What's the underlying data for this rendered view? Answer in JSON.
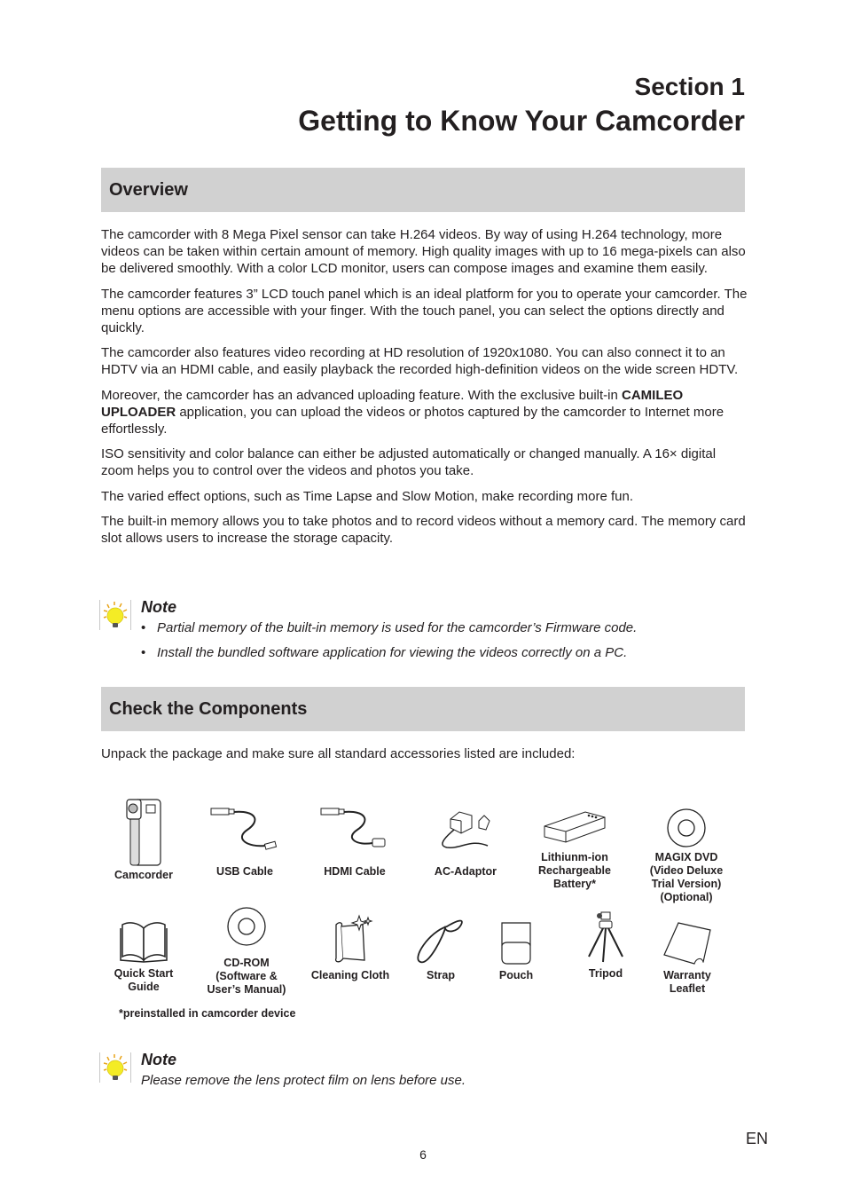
{
  "header": {
    "section_label": "Section 1",
    "section_title": "Getting to Know Your Camcorder"
  },
  "overview": {
    "heading": "Overview",
    "paragraphs": {
      "p1": "The camcorder with 8 Mega Pixel sensor can take H.264 videos. By way of using H.264 technology, more videos can be taken within certain amount of memory. High quality images with up to 16 mega-pixels can also be delivered smoothly. With a color LCD monitor, users can compose images and examine them easily.",
      "p2": "The camcorder features 3” LCD touch panel which is an ideal platform for you to operate your camcorder. The menu options are accessible with your finger. With the touch panel, you can select the options directly and quickly.",
      "p3": "The camcorder also features video recording at HD resolution of 1920x1080. You can also connect it to an HDTV via an HDMI cable, and easily playback the recorded high-definition videos on the wide screen HDTV.",
      "p4_before": "Moreover, the camcorder has an advanced uploading feature. With the exclusive built-in ",
      "p4_bold": "CAMILEO UPLOADER",
      "p4_after": " application, you can upload the videos or photos captured by the camcorder to Internet more effortlessly.",
      "p5": "ISO sensitivity and color balance can either be adjusted automatically or changed manually. A 16× digital zoom helps you to control over the videos and photos you take.",
      "p6": "The varied effect options, such as Time Lapse and Slow Motion, make recording more fun.",
      "p7": "The built-in memory allows you to take photos and to record videos without a memory card. The memory card slot allows users to increase the storage capacity."
    },
    "note": {
      "icon": "lightbulb-icon",
      "title": "Note",
      "bullet": "•",
      "items": [
        "Partial memory of the built-in memory is used for the camcorder’s Firmware code.",
        "Install the bundled software application for viewing the videos correctly on a PC."
      ]
    }
  },
  "components": {
    "heading": "Check the Components",
    "intro": "Unpack the package and make sure all standard accessories listed are included:",
    "items": [
      {
        "label": "Camcorder",
        "icon": "camcorder-icon"
      },
      {
        "label": "USB Cable",
        "icon": "usb-cable-icon"
      },
      {
        "label": "HDMI Cable",
        "icon": "hdmi-cable-icon"
      },
      {
        "label": "AC-Adaptor",
        "icon": "ac-adaptor-icon"
      },
      {
        "label": "Lithiunm-ion Rechargeable Battery*",
        "icon": "battery-icon"
      },
      {
        "label": "MAGIX DVD (Video Deluxe Trial Version) (Optional)",
        "icon": "dvd-icon"
      },
      {
        "label": "Quick Start Guide",
        "icon": "book-icon"
      },
      {
        "label": "CD-ROM (Software & User’s Manual)",
        "icon": "cd-icon"
      },
      {
        "label": "Cleaning Cloth",
        "icon": "cleaning-cloth-icon"
      },
      {
        "label": "Strap",
        "icon": "strap-icon"
      },
      {
        "label": "Pouch",
        "icon": "pouch-icon"
      },
      {
        "label": "Tripod",
        "icon": "tripod-icon"
      },
      {
        "label": "Warranty Leaflet",
        "icon": "leaflet-icon"
      }
    ],
    "footnote": "*preinstalled in camcorder device",
    "note": {
      "icon": "lightbulb-icon",
      "title": "Note",
      "text": "Please remove the lens protect film on lens before use."
    }
  },
  "footer": {
    "page_number": "6",
    "language": "EN"
  }
}
